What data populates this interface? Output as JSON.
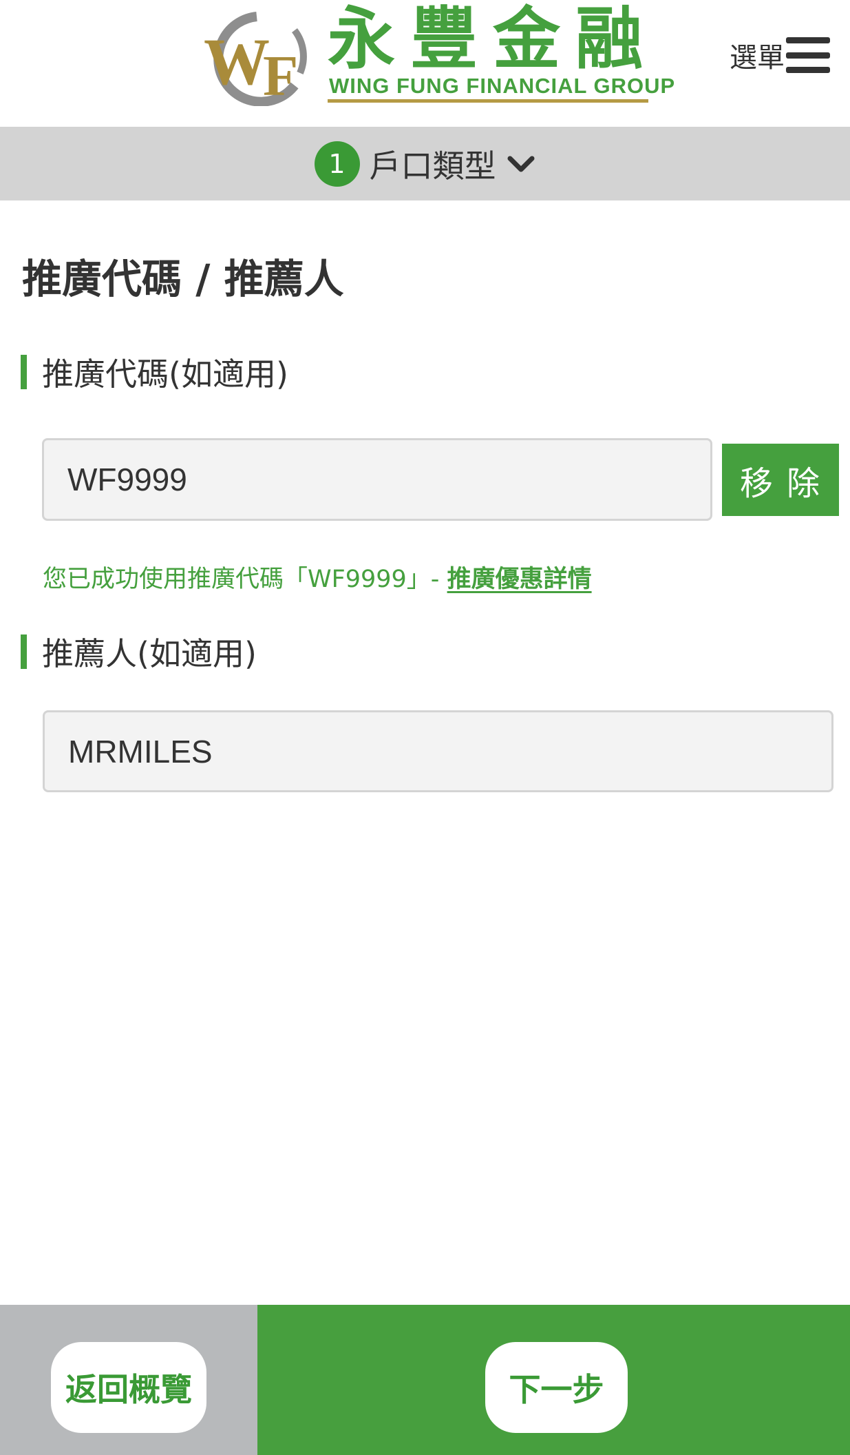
{
  "header": {
    "logo_cn": "永豐金融",
    "logo_en": "WING FUNG FINANCIAL GROUP",
    "logo_emblem_text": "WF",
    "menu_label": "選單",
    "brand_color": "#45a03e",
    "gold_color": "#b59a44"
  },
  "step": {
    "number": "1",
    "label": "戶口類型"
  },
  "section": {
    "title": "推廣代碼 / 推薦人"
  },
  "promo": {
    "label": "推廣代碼(如適用)",
    "value": "WF9999",
    "remove_label": "移除",
    "success_text": "您已成功使用推廣代碼「WF9999」- ",
    "details_link": "推廣優惠詳情"
  },
  "referrer": {
    "label": "推薦人(如適用)",
    "value": "MRMILES"
  },
  "footer": {
    "back_label": "返回概覽",
    "next_label": "下一步"
  }
}
